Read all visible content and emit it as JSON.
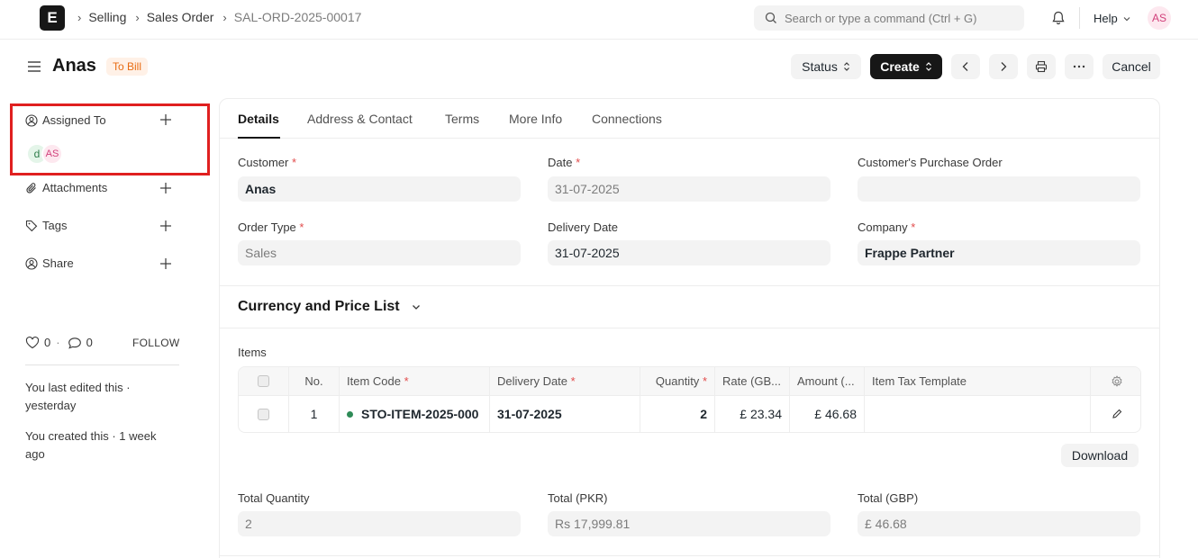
{
  "navbar": {
    "logo": "E",
    "breadcrumbs": [
      "Selling",
      "Sales Order",
      "SAL-ORD-2025-00017"
    ],
    "search_placeholder": "Search or type a command (Ctrl + G)",
    "help_label": "Help",
    "avatar_initials": "AS"
  },
  "page": {
    "title": "Anas",
    "status_badge": "To Bill",
    "buttons": {
      "status": "Status",
      "create": "Create",
      "cancel": "Cancel"
    }
  },
  "sidebar": {
    "assigned_to": "Assigned To",
    "assignees": [
      "d",
      "AS"
    ],
    "attachments": "Attachments",
    "tags": "Tags",
    "share": "Share",
    "likes": "0",
    "comments": "0",
    "follow": "FOLLOW",
    "last_edited": "You last edited this · yesterday",
    "created": "You created this · 1 week ago"
  },
  "tabs": [
    "Details",
    "Address & Contact",
    "Terms",
    "More Info",
    "Connections"
  ],
  "form": {
    "customer": {
      "label": "Customer",
      "value": "Anas"
    },
    "date": {
      "label": "Date",
      "value": "31-07-2025"
    },
    "customer_po": {
      "label": "Customer's Purchase Order",
      "value": ""
    },
    "order_type": {
      "label": "Order Type",
      "value": "Sales"
    },
    "delivery_date": {
      "label": "Delivery Date",
      "value": "31-07-2025"
    },
    "company": {
      "label": "Company",
      "value": "Frappe Partner"
    }
  },
  "section": {
    "currency_price_list": "Currency and Price List"
  },
  "items": {
    "label": "Items",
    "columns": [
      "No.",
      "Item Code",
      "Delivery Date",
      "Quantity",
      "Rate (GB...",
      "Amount (...",
      "Item Tax Template"
    ],
    "rows": [
      {
        "no": "1",
        "item_code": "STO-ITEM-2025-000",
        "delivery_date": "31-07-2025",
        "quantity": "2",
        "rate": "£ 23.34",
        "amount": "£ 46.68",
        "tax_template": ""
      }
    ],
    "download": "Download"
  },
  "totals": {
    "total_quantity": {
      "label": "Total Quantity",
      "value": "2"
    },
    "total_pkr": {
      "label": "Total (PKR)",
      "value": "Rs 17,999.81"
    },
    "total_gbp": {
      "label": "Total (GBP)",
      "value": "£ 46.68"
    }
  }
}
